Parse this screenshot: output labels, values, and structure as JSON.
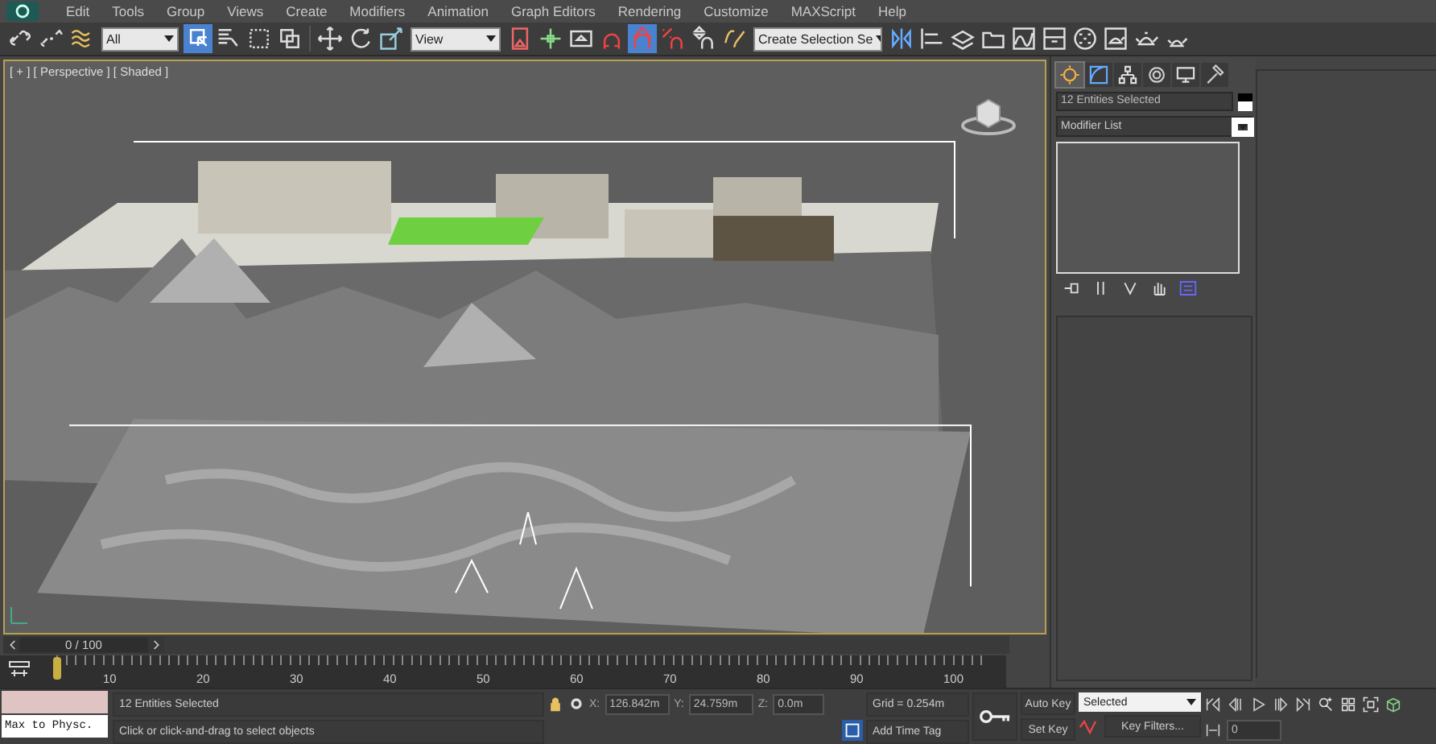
{
  "menu_bar": {
    "items": [
      "Edit",
      "Tools",
      "Group",
      "Views",
      "Create",
      "Modifiers",
      "Animation",
      "Graph Editors",
      "Rendering",
      "Customize",
      "MAXScript",
      "Help"
    ]
  },
  "main_toolbar": {
    "selection_filter": "All",
    "reference_coordinate_system": "View",
    "named_selection_set": "Create Selection Se",
    "buttons": [
      {
        "selected": false
      },
      {
        "selected": false
      },
      {
        "selected": false
      },
      {
        "selected": true
      },
      {
        "selected": false
      },
      {
        "selected": false
      },
      {
        "selected": false
      },
      {
        "selected": false
      },
      {
        "selected": false
      },
      {
        "selected": false
      },
      {
        "selected": false
      },
      {
        "selected": false
      },
      {
        "selected": false
      },
      {
        "selected": false
      },
      {
        "selected": true
      },
      {
        "selected": false
      },
      {
        "selected": false
      },
      {
        "selected": false
      },
      {
        "selected": false
      },
      {
        "selected": false
      },
      {
        "selected": false
      },
      {
        "selected": false
      },
      {
        "selected": false
      },
      {
        "selected": false
      },
      {
        "selected": false
      },
      {
        "selected": false
      },
      {
        "selected": false
      },
      {
        "selected": false
      }
    ]
  },
  "viewport": {
    "label": "[ + ] [ Perspective ] [ Shaded ]"
  },
  "command_panel": {
    "tabs": [
      {
        "selected": true
      },
      {
        "selected": false
      },
      {
        "selected": false
      },
      {
        "selected": false
      },
      {
        "selected": false
      },
      {
        "selected": false
      }
    ],
    "object_name": "12 Entities Selected",
    "modifier_list": "Modifier List"
  },
  "time_slider": {
    "frame": "0 / 100",
    "ruler_labels": [
      "10",
      "20",
      "30",
      "40",
      "50",
      "60",
      "70",
      "80",
      "90",
      "100"
    ]
  },
  "status_bar": {
    "listener": "Max to Physc.",
    "selection_info": "12 Entities Selected",
    "prompt": "Click or click-and-drag to select objects",
    "x_label": "X:",
    "x": "126.842m",
    "y_label": "Y:",
    "y": "24.759m",
    "z_label": "Z:",
    "z": "0.0m",
    "grid": "Grid = 0.254m",
    "time_tag": "Add Time Tag",
    "auto_key": "Auto Key",
    "set_key": "Set Key",
    "key_mode": "Selected",
    "key_filters": "Key Filters...",
    "current_frame": "0"
  }
}
